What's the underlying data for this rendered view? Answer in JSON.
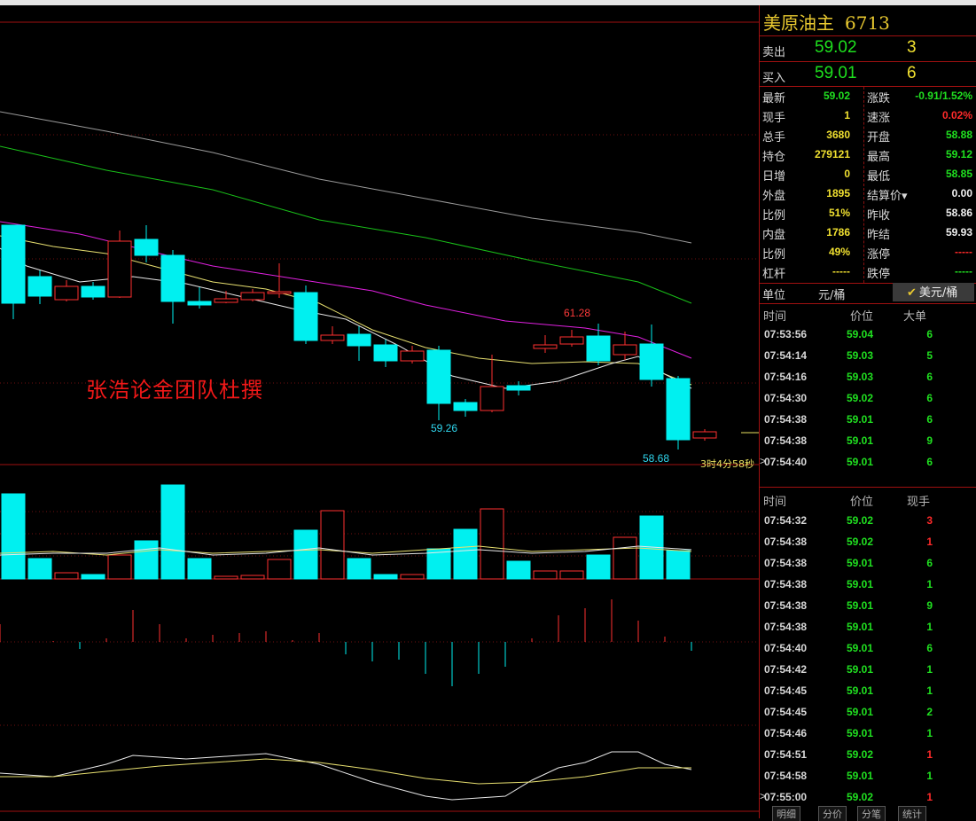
{
  "symbol": {
    "name": "美原油主",
    "code": "6713"
  },
  "watermark": "张浩论金团队杜撰",
  "countdown": "3时4分58秒",
  "annotations": {
    "high": "61.28",
    "low1": "59.26",
    "low2": "58.68"
  },
  "quote": {
    "sell": {
      "label": "卖出",
      "price": "59.02",
      "volume": "3"
    },
    "buy": {
      "label": "买入",
      "price": "59.01",
      "volume": "6"
    }
  },
  "stats_left": [
    {
      "k": "最新",
      "v": "59.02",
      "color": "green"
    },
    {
      "k": "现手",
      "v": "1",
      "color": "yellow"
    },
    {
      "k": "总手",
      "v": "3680",
      "color": "yellow"
    },
    {
      "k": "持仓",
      "v": "279121",
      "color": "yellow"
    },
    {
      "k": "日增",
      "v": "0",
      "color": "yellow"
    },
    {
      "k": "外盘",
      "v": "1895",
      "color": "yellow"
    },
    {
      "k": "比例",
      "v": "51%",
      "color": "yellow"
    },
    {
      "k": "内盘",
      "v": "1786",
      "color": "yellow"
    },
    {
      "k": "比例",
      "v": "49%",
      "color": "yellow"
    },
    {
      "k": "杠杆",
      "v": "-----",
      "color": "yellow"
    }
  ],
  "stats_right": [
    {
      "k": "涨跌",
      "v": "-0.91/1.52%",
      "color": "green"
    },
    {
      "k": "速涨",
      "v": "0.02%",
      "color": "red"
    },
    {
      "k": "开盘",
      "v": "58.88",
      "color": "green"
    },
    {
      "k": "最高",
      "v": "59.12",
      "color": "green"
    },
    {
      "k": "最低",
      "v": "58.85",
      "color": "green"
    },
    {
      "k": "结算价▾",
      "v": "0.00",
      "color": "white"
    },
    {
      "k": "昨收",
      "v": "58.86",
      "color": "white"
    },
    {
      "k": "昨结",
      "v": "59.93",
      "color": "white"
    },
    {
      "k": "涨停",
      "v": "-----",
      "color": "red"
    },
    {
      "k": "跌停",
      "v": "-----",
      "color": "green"
    }
  ],
  "unit": {
    "label": "单位",
    "opt1": "元/桶",
    "check": "✔",
    "opt2": "美元/桶"
  },
  "big_orders": {
    "headers": [
      "时间",
      "价位",
      "大单"
    ],
    "rows": [
      {
        "t": "07:53:56",
        "p": "59.04",
        "n": "6",
        "c": "green"
      },
      {
        "t": "07:54:14",
        "p": "59.03",
        "n": "5",
        "c": "green"
      },
      {
        "t": "07:54:16",
        "p": "59.03",
        "n": "6",
        "c": "green"
      },
      {
        "t": "07:54:30",
        "p": "59.02",
        "n": "6",
        "c": "green"
      },
      {
        "t": "07:54:38",
        "p": "59.01",
        "n": "6",
        "c": "green"
      },
      {
        "t": "07:54:38",
        "p": "59.01",
        "n": "9",
        "c": "green"
      },
      {
        "t": "07:54:40",
        "p": "59.01",
        "n": "6",
        "c": "green"
      }
    ]
  },
  "ticks": {
    "headers": [
      "时间",
      "价位",
      "现手"
    ],
    "rows": [
      {
        "t": "07:54:32",
        "p": "59.02",
        "n": "3",
        "c": "red"
      },
      {
        "t": "07:54:38",
        "p": "59.02",
        "n": "1",
        "c": "red"
      },
      {
        "t": "07:54:38",
        "p": "59.01",
        "n": "6",
        "c": "green"
      },
      {
        "t": "07:54:38",
        "p": "59.01",
        "n": "1",
        "c": "green"
      },
      {
        "t": "07:54:38",
        "p": "59.01",
        "n": "9",
        "c": "green"
      },
      {
        "t": "07:54:38",
        "p": "59.01",
        "n": "1",
        "c": "green"
      },
      {
        "t": "07:54:40",
        "p": "59.01",
        "n": "6",
        "c": "green"
      },
      {
        "t": "07:54:42",
        "p": "59.01",
        "n": "1",
        "c": "green"
      },
      {
        "t": "07:54:45",
        "p": "59.01",
        "n": "1",
        "c": "green"
      },
      {
        "t": "07:54:45",
        "p": "59.01",
        "n": "2",
        "c": "green"
      },
      {
        "t": "07:54:46",
        "p": "59.01",
        "n": "1",
        "c": "green"
      },
      {
        "t": "07:54:51",
        "p": "59.02",
        "n": "1",
        "c": "red"
      },
      {
        "t": "07:54:58",
        "p": "59.01",
        "n": "1",
        "c": "green"
      },
      {
        "t": "07:55:00",
        "p": "59.02",
        "n": "1",
        "c": "red"
      }
    ]
  },
  "tabs": [
    "明细",
    "分价",
    "分笔",
    "统计"
  ],
  "colors": {
    "up": "#ff3030",
    "down": "#00f0f0",
    "ma_grey": "#9a9a9a",
    "ma_green": "#19c019",
    "ma_magenta": "#e020e0",
    "ma_yellow": "#e8e070",
    "ma_white": "#e8e8e8",
    "grid": "#a01010"
  }
}
